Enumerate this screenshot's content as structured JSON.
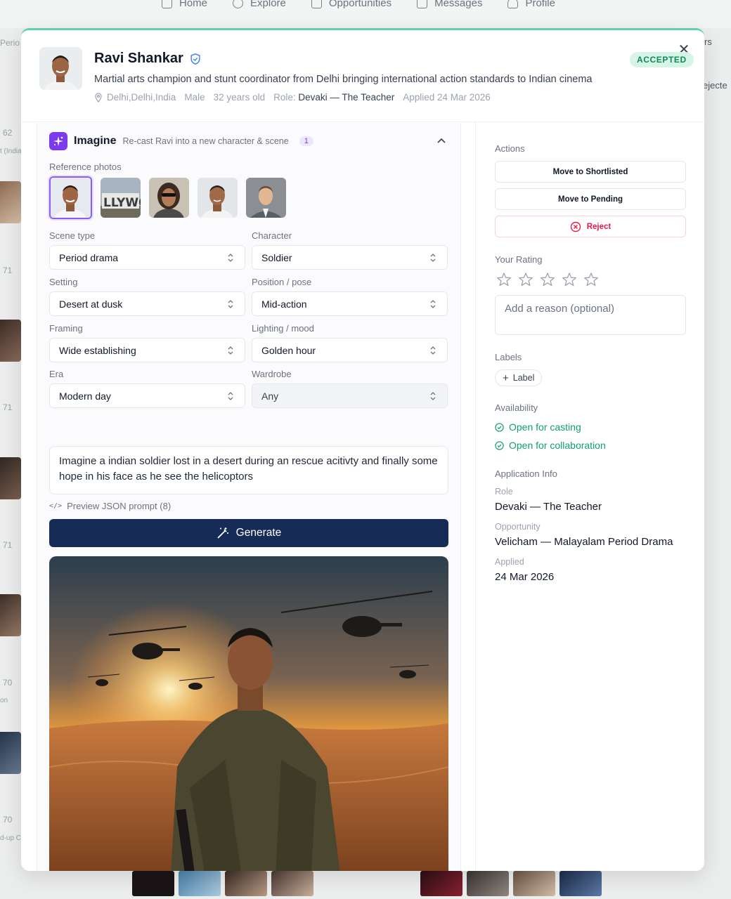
{
  "background": {
    "nav": [
      "Home",
      "Explore",
      "Opportunities",
      "Messages",
      "Profile"
    ],
    "left_fragments": [
      "Perio",
      "62",
      "t (India",
      "71",
      "71",
      "71",
      "70",
      "on",
      "70",
      "d-up C"
    ],
    "right_fragments": [
      "rs",
      "ejecte"
    ]
  },
  "profile": {
    "name": "Ravi Shankar",
    "status": "ACCEPTED",
    "bio": "Martial arts champion and stunt coordinator from Delhi bringing international action standards to Indian cinema",
    "location": "Delhi,Delhi,India",
    "gender": "Male",
    "age": "32 years old",
    "role_label": "Role:",
    "role_value": "Devaki — The Teacher",
    "applied": "Applied 24 Mar 2026"
  },
  "imagine": {
    "title": "Imagine",
    "subtitle": "Re-cast Ravi into a new character & scene",
    "count": "1",
    "reference_label": "Reference photos",
    "fields": [
      {
        "label": "Scene type",
        "value": "Period drama"
      },
      {
        "label": "Character",
        "value": "Soldier"
      },
      {
        "label": "Setting",
        "value": "Desert at dusk"
      },
      {
        "label": "Position / pose",
        "value": "Mid-action"
      },
      {
        "label": "Framing",
        "value": "Wide establishing"
      },
      {
        "label": "Lighting / mood",
        "value": "Golden hour"
      },
      {
        "label": "Era",
        "value": "Modern day"
      },
      {
        "label": "Wardrobe",
        "value": "Any"
      }
    ],
    "prompt": "Imagine a indian soldier lost in a desert during an rescue acitivty and finally some hope in his face as he see the helicoptors",
    "json_preview": "Preview JSON prompt (8)",
    "generate_label": "Generate"
  },
  "actions": {
    "title": "Actions",
    "shortlist": "Move to Shortlisted",
    "pending": "Move to Pending",
    "reject": "Reject"
  },
  "rating": {
    "title": "Your Rating",
    "stars": 0,
    "max": 5,
    "reason_placeholder": "Add a reason (optional)"
  },
  "labels": {
    "title": "Labels",
    "add": "Label"
  },
  "availability": {
    "title": "Availability",
    "items": [
      "Open for casting",
      "Open for collaboration"
    ]
  },
  "application_info": {
    "title": "Application Info",
    "role_key": "Role",
    "role": "Devaki — The Teacher",
    "opportunity_key": "Opportunity",
    "opportunity": "Velicham — Malayalam Period Drama",
    "applied_key": "Applied",
    "applied": "24 Mar 2026"
  },
  "colors": {
    "accent_purple": "#7c3aed",
    "primary_navy": "#172b57",
    "success_green": "#10a06a",
    "danger_red": "#e11d48"
  }
}
